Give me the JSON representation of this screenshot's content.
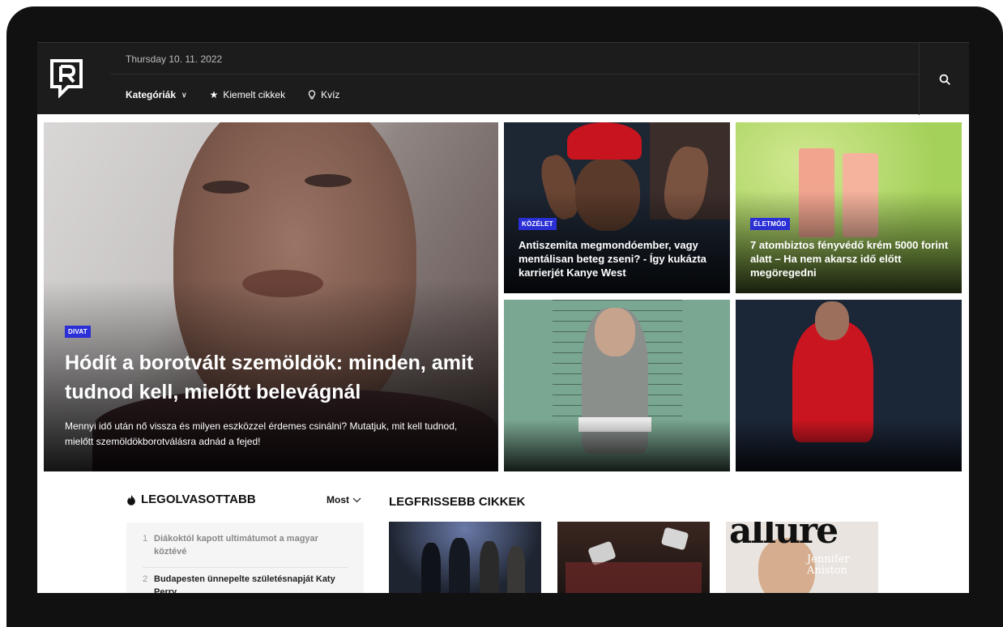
{
  "header": {
    "date": "Thursday 10. 11. 2022",
    "nav": [
      {
        "label": "Kategóriák",
        "icon": "chevron-down-icon"
      },
      {
        "label": "Kiemelt cikkek",
        "icon": "star-icon"
      },
      {
        "label": "Kvíz",
        "icon": "lightbulb-icon"
      }
    ]
  },
  "hero": {
    "badge": "DIVAT",
    "title": "Hódít a borotvált szemöldök: minden, amit tudnod kell, mielőtt belevágnál",
    "lead": "Mennyi idő után nő vissza és milyen eszközzel érdemes csinálni? Mutatjuk, mit kell tudnod, mielőtt szemöldökborotválásra adnád a fejed!"
  },
  "cards": [
    {
      "badge": "KÖZÉLET",
      "title": "Antiszemita megmondóember, vagy mentálisan beteg zseni? - Így kukázta karrierjét Kanye West"
    },
    {
      "badge": "ÉLETMÓD",
      "title": "7 atombiztos fényvédő krém 5000 forint alatt – Ha nem akarsz idő előtt megöregedni"
    }
  ],
  "most_read": {
    "title": "LEGOLVASOTTABB",
    "filter": "Most",
    "items": [
      {
        "num": "1",
        "text": "Diákoktól kapott ultimátumot a magyar köztévé"
      },
      {
        "num": "2",
        "text": "Budapesten ünnepelte születésnapját Katy Perry"
      }
    ]
  },
  "latest": {
    "title": "LEGFRISSEBB CIKKEK",
    "magazine_text": "allure",
    "magazine_cover_name": "Jennifer Aniston"
  },
  "colors": {
    "header_bg": "#1c1c1c",
    "badge_bg": "#2a2fd6"
  }
}
